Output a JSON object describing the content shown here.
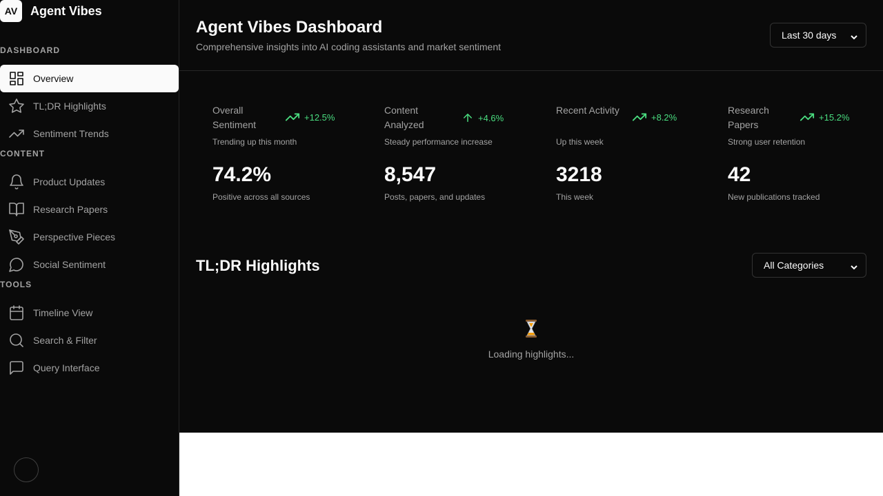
{
  "brand": {
    "logo_text": "AV",
    "name": "Agent Vibes"
  },
  "sidebar": {
    "sections": [
      {
        "label": "DASHBOARD",
        "items": [
          {
            "label": "Overview",
            "icon": "grid-icon",
            "active": true
          },
          {
            "label": "TL;DR Highlights",
            "icon": "star-icon"
          },
          {
            "label": "Sentiment Trends",
            "icon": "trending-up-icon"
          }
        ]
      },
      {
        "label": "CONTENT",
        "items": [
          {
            "label": "Product Updates",
            "icon": "bell-icon"
          },
          {
            "label": "Research Papers",
            "icon": "book-icon"
          },
          {
            "label": "Perspective Pieces",
            "icon": "pen-icon"
          },
          {
            "label": "Social Sentiment",
            "icon": "chat-bubble-icon"
          }
        ]
      },
      {
        "label": "TOOLS",
        "items": [
          {
            "label": "Timeline View",
            "icon": "calendar-icon"
          },
          {
            "label": "Search & Filter",
            "icon": "search-icon"
          },
          {
            "label": "Query Interface",
            "icon": "message-square-icon"
          }
        ]
      }
    ]
  },
  "header": {
    "title": "Agent Vibes Dashboard",
    "subtitle": "Comprehensive insights into AI coding assistants and market sentiment",
    "range_select": "Last 30 days"
  },
  "stats": [
    {
      "title": "Overall Sentiment",
      "trend": "+12.5%",
      "trend_icon": "trending-up-icon",
      "desc": "Trending up this month",
      "value": "74.2%",
      "note": "Positive across all sources"
    },
    {
      "title": "Content Analyzed",
      "trend": "+4.6%",
      "trend_icon": "arrow-up-icon",
      "desc": "Steady performance increase",
      "value": "8,547",
      "note": "Posts, papers, and updates"
    },
    {
      "title": "Recent Activity",
      "trend": "+8.2%",
      "trend_icon": "trending-up-icon",
      "desc": "Up this week",
      "value": "3218",
      "note": "This week"
    },
    {
      "title": "Research Papers",
      "trend": "+15.2%",
      "trend_icon": "trending-up-icon",
      "desc": "Strong user retention",
      "value": "42",
      "note": "New publications tracked"
    }
  ],
  "highlights": {
    "title": "TL;DR Highlights",
    "category_select": "All Categories",
    "loading_text": "Loading highlights..."
  },
  "colors": {
    "background": "#0a0a0a",
    "accent_positive": "#4ade80",
    "text": "#fafafa",
    "muted": "#a3a3a3"
  }
}
